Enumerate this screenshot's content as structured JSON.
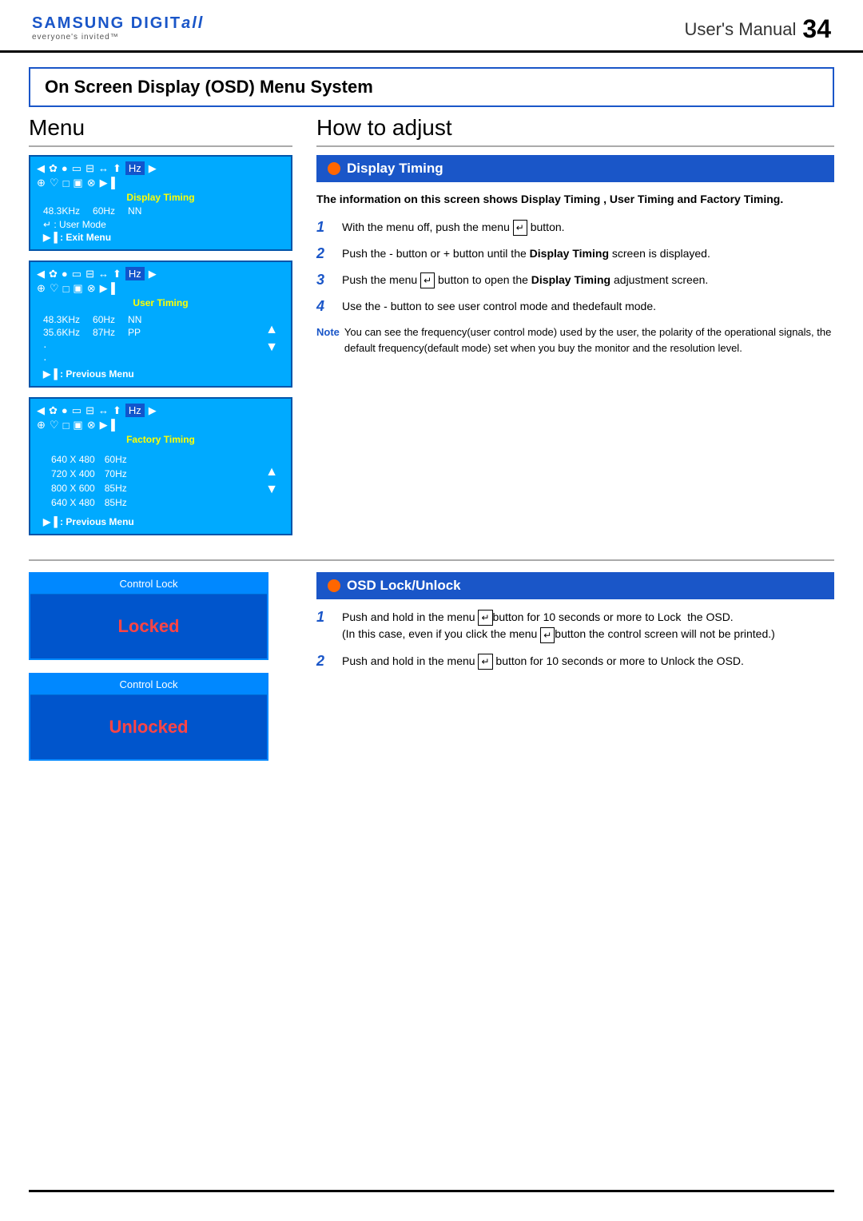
{
  "header": {
    "logo_brand": "SAMSUNG",
    "logo_digital": "DIGIT",
    "logo_all": "all",
    "logo_tagline": "everyone's invited™",
    "manual_label": "User's Manual",
    "page_number": "34"
  },
  "section_title": "On Screen Display (OSD) Menu System",
  "menu_col_header": "Menu",
  "how_col_header": "How to adjust",
  "osd_panel1": {
    "label": "Display Timing",
    "freq": "48.3KHz",
    "hz": "60Hz",
    "mode": "NN",
    "enter_label": "↵ : User Mode",
    "exit_label": "▶▐ : Exit Menu"
  },
  "osd_panel2": {
    "label": "User Timing",
    "row1_freq": "48.3KHz",
    "row1_hz": "60Hz",
    "row1_mode": "NN",
    "row2_freq": "35.6KHz",
    "row2_hz": "87Hz",
    "row2_mode": "PP",
    "prev_label": "▶▐ : Previous Menu"
  },
  "osd_panel3": {
    "label": "Factory Timing",
    "rows": [
      {
        "res": "640 X 480",
        "hz": "60Hz"
      },
      {
        "res": "720 X 400",
        "hz": "70Hz"
      },
      {
        "res": "800 X 600",
        "hz": "85Hz"
      },
      {
        "res": "640 X 480",
        "hz": "85Hz"
      }
    ],
    "prev_label": "▶▐ : Previous Menu"
  },
  "display_timing_section": {
    "title": "Display Timing",
    "bold_text": "The information on this screen shows Display Timing , User Timing and Factory Timing.",
    "steps": [
      {
        "num": "1",
        "text_before": "With the menu off, push the menu ",
        "btn": "↵",
        "text_after": " button."
      },
      {
        "num": "2",
        "text_before": "Push the - button or  + button until the ",
        "bold": "Display Timing",
        "text_after": " screen is displayed."
      },
      {
        "num": "3",
        "text_before": "Push the menu ",
        "btn": "↵",
        "text_middle": " button to open the ",
        "bold": "Display Timing",
        "text_after": " adjustment screen."
      },
      {
        "num": "4",
        "text_before": "Use the - button to see user control mode and thedefault mode."
      }
    ],
    "note_label": "Note",
    "note_text": "You can see the frequency(user control mode) used by the user, the polarity of the operational signals, the default frequency(default mode) set when you buy the monitor and the resolution level."
  },
  "osd_lock_section": {
    "title": "OSD Lock/Unlock",
    "steps": [
      {
        "num": "1",
        "text_before": "Push and hold in the menu ",
        "btn": "↵",
        "text_after": "button for 10 seconds or more to Lock  the OSD.\n(In this case, even if you click the menu ",
        "btn2": "↵",
        "text_after2": "button the control screen will not be printed.)"
      },
      {
        "num": "2",
        "text_before": "Push and hold in the menu ",
        "btn": "↵",
        "text_after": " button for 10 seconds or more to Unlock the OSD."
      }
    ]
  },
  "control_lock_box1": {
    "title": "Control Lock",
    "status": "Locked"
  },
  "control_lock_box2": {
    "title": "Control Lock",
    "status": "Unlocked"
  }
}
